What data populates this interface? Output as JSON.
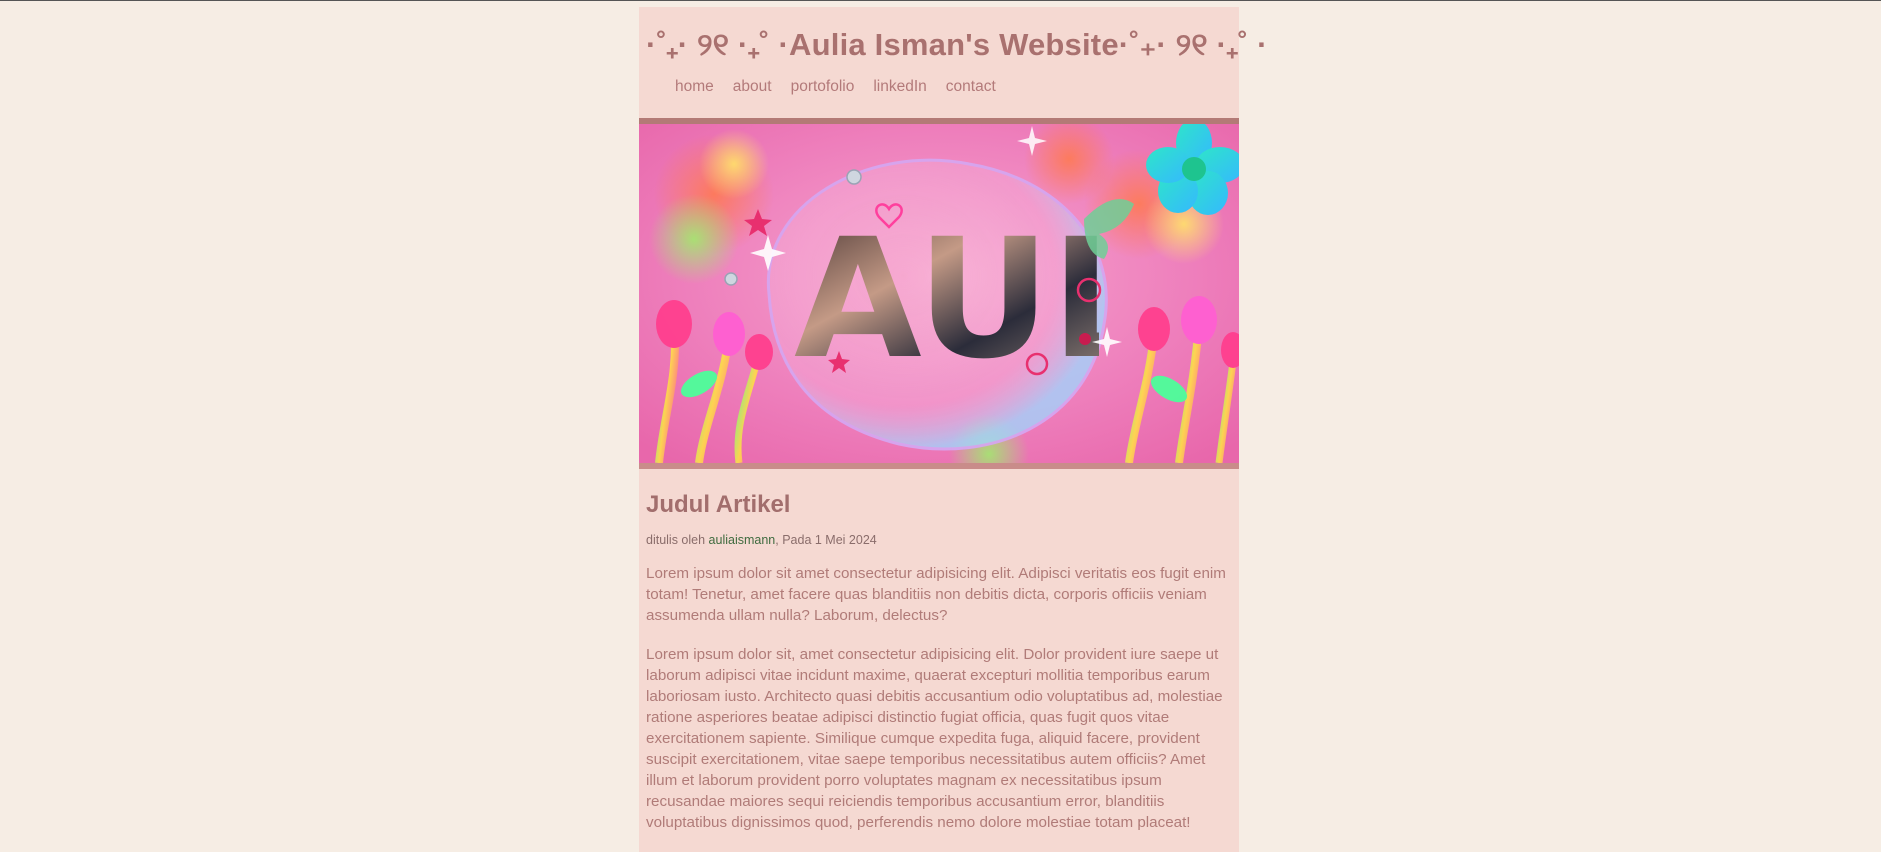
{
  "header": {
    "title": "·˚₊· ୨୧ ·₊˚ ·Aulia Isman's Website·˚₊· ୨୧ ·₊˚ ·",
    "nav": [
      "home",
      "about",
      "portofolio",
      "linkedIn",
      "contact"
    ]
  },
  "hero": {
    "letters": "AUL",
    "alt": "colorful pink banner with bubble and AUL letters"
  },
  "article": {
    "title": "Judul Artikel",
    "meta_prefix": "ditulis oleh ",
    "author": "auliaismann",
    "meta_suffix": ", Pada 1 Mei 2024",
    "paragraphs": [
      "Lorem ipsum dolor sit amet consectetur adipisicing elit. Adipisci veritatis eos fugit enim totam! Tenetur, amet facere quas blanditiis non debitis dicta, corporis officiis veniam assumenda ullam nulla? Laborum, delectus?",
      "Lorem ipsum dolor sit, amet consectetur adipisicing elit. Dolor provident iure saepe ut laborum adipisci vitae incidunt maxime, quaerat excepturi mollitia temporibus earum laboriosam iusto. Architecto quasi debitis accusantium odio voluptatibus ad, molestiae ratione asperiores beatae adipisci distinctio fugiat officia, quas fugit quos vitae exercitationem sapiente. Similique cumque expedita fuga, aliquid facere, provident suscipit exercitationem, vitae saepe temporibus necessitatibus autem officiis? Amet illum et laborum provident porro voluptates magnam ex necessitatibus ipsum recusandae maiores sequi reiciendis temporibus accusantium error, blanditiis voluptatibus dignissimos quod, perferendis nemo dolore molestiae totam placeat!"
    ]
  },
  "colors": {
    "page_bg": "#f6ede4",
    "card_bg": "#f5d9d2",
    "title": "#a9716f",
    "link_author": "#3f6b3f"
  }
}
